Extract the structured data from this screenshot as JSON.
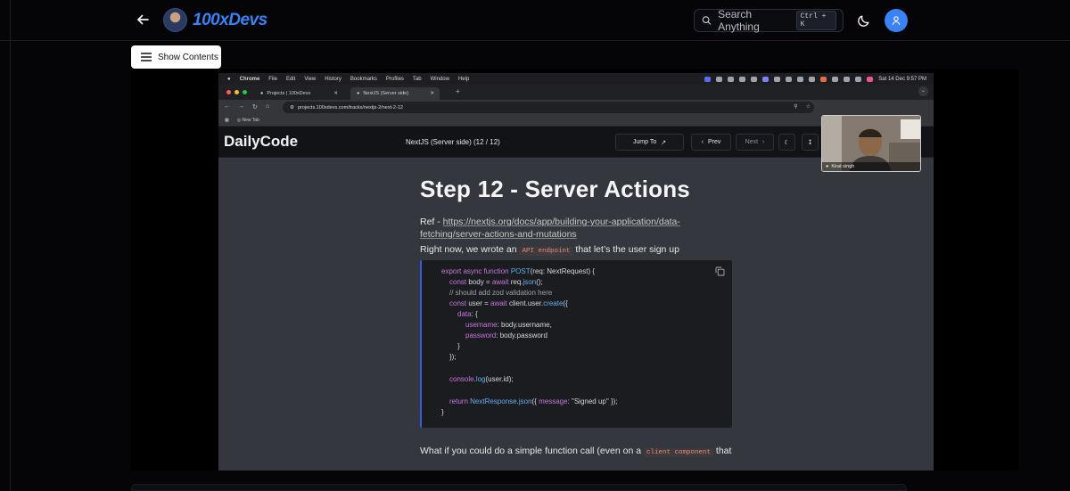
{
  "app": {
    "brand": "100xDevs",
    "search_placeholder": "Search Anything",
    "search_shortcut": "Ctrl + K",
    "show_contents_label": "Show Contents"
  },
  "mac_menu": [
    "Chrome",
    "File",
    "Edit",
    "View",
    "History",
    "Bookmarks",
    "Profiles",
    "Tab",
    "Window",
    "Help"
  ],
  "mac_clock": "Sat 14 Dec  9:57 PM",
  "browser": {
    "tabs": [
      {
        "label": "Projects | 100xDevs",
        "active": false
      },
      {
        "label": "NextJS (Server side)",
        "active": true
      }
    ],
    "url": "projects.100xdevs.com/tracks/nextjs-2/next-2-12",
    "bookmark": "New Tab"
  },
  "dailycode": {
    "brand": "DailyCode",
    "title": "NextJS (Server side) (12 / 12)",
    "jump_label": "Jump To",
    "prev_label": "Prev",
    "next_label": "Next"
  },
  "lesson": {
    "heading": "Step 12 - Server Actions",
    "ref_prefix": "Ref - ",
    "ref_link_line1": "https://nextjs.org/docs/app/building-your-application/data-",
    "ref_link_line2": "fetching/server-actions-and-mutations",
    "para1_before": "Right now, we wrote an ",
    "para1_code": "API endpoint",
    "para1_after": " that let’s the user sign up",
    "para2_before": "What if you could do a simple function call (even on a ",
    "para2_code": "client component",
    "para2_after": " that"
  },
  "code": {
    "l1_kw": "export async function ",
    "l1_fn": "POST",
    "l1_rest": "(req: NextRequest) {",
    "l2_kw": "const ",
    "l2_a": "body = ",
    "l2_kw2": "await ",
    "l2_b": "req.",
    "l2_fn": "json",
    "l2_c": "();",
    "l3": "// should add zod validation here",
    "l4_kw": "const ",
    "l4_a": "user = ",
    "l4_kw2": "await ",
    "l4_b": "client.user.",
    "l4_fn": "create",
    "l4_c": "({",
    "l5_prop": "data",
    "l5_c": ": {",
    "l6_prop": "username",
    "l6_c": ": body.username,",
    "l7_prop": "password",
    "l7_c": ": body.password",
    "l8": "}",
    "l9": "});",
    "l10_fn": "console",
    "l10_a": ".",
    "l10_fn2": "log",
    "l10_b": "(user.id);",
    "l11_kw": "return ",
    "l11_fn": "NextResponse",
    "l11_a": ".",
    "l11_fn2": "json",
    "l11_b": "({ ",
    "l11_prop": "message",
    "l11_c": ": \"Signed up\" });",
    "l12": "}"
  },
  "pip": {
    "name": "Kirat singh"
  },
  "colors": {
    "accent": "#3b82f6",
    "background": "#050507",
    "code_border": "#3b5bdb"
  }
}
